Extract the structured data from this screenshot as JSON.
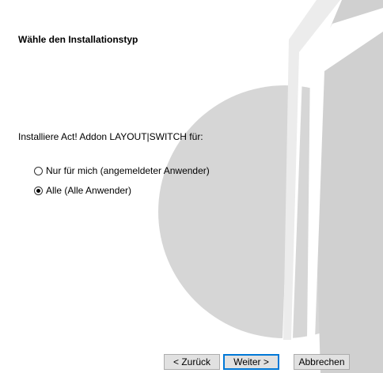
{
  "heading": "Wähle den Installationstyp",
  "prompt": "Installiere Act! Addon LAYOUT|SWITCH für:",
  "options": [
    {
      "label": "Nur für mich (angemeldeter Anwender)",
      "checked": false
    },
    {
      "label": "Alle (Alle Anwender)",
      "checked": true
    }
  ],
  "buttons": {
    "back": "< Zurück",
    "next": "Weiter >",
    "cancel": "Abbrechen"
  },
  "colors": {
    "background": "#ffffff",
    "watermark": "#d9d9d9",
    "button_face": "#e1e1e1",
    "default_button_border": "#0078d7"
  }
}
